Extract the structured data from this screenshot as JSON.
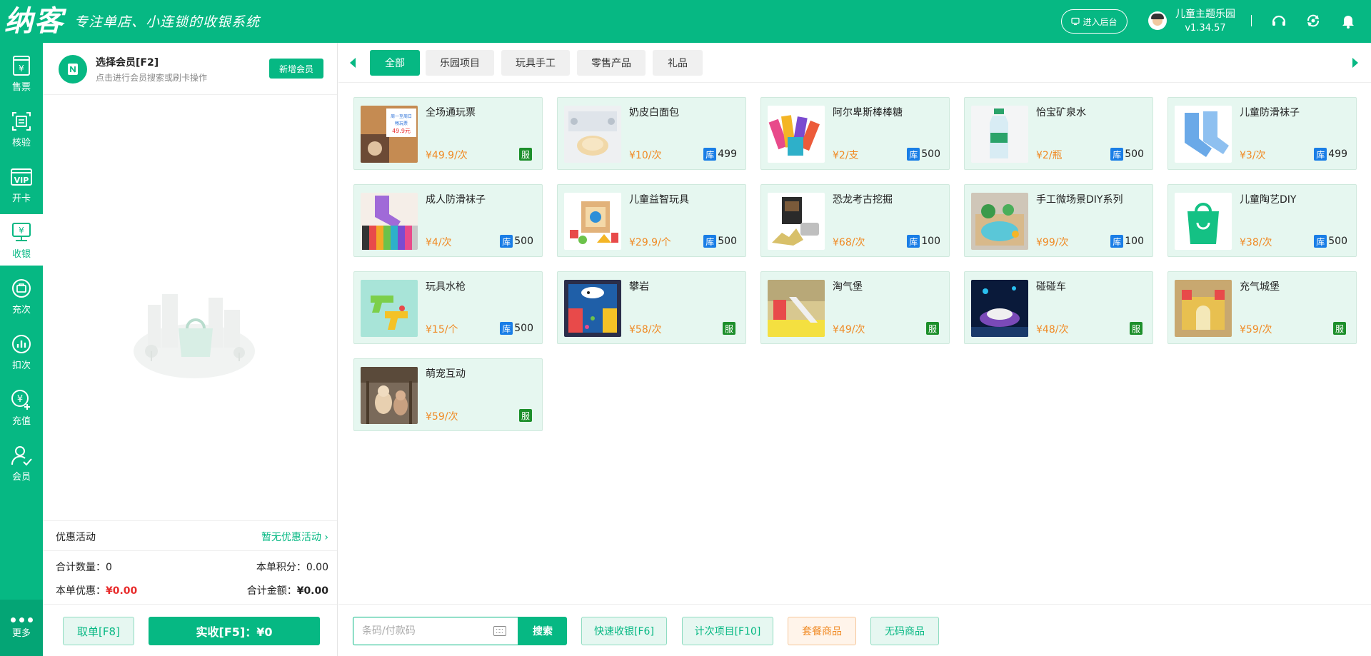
{
  "header": {
    "logo": "纳客",
    "slogan": "专注单店、小连锁的收银系统",
    "backend_label": "进入后台",
    "store_name": "儿童主题乐园",
    "version": "v1.34.57",
    "icons": [
      "headset-icon",
      "sync-icon",
      "bell-icon"
    ]
  },
  "nav": {
    "items": [
      {
        "label": "售票",
        "icon": "ticket-icon"
      },
      {
        "label": "核验",
        "icon": "verify-icon"
      },
      {
        "label": "开卡",
        "icon": "vip-card-icon"
      },
      {
        "label": "收银",
        "icon": "cashier-icon"
      },
      {
        "label": "充次",
        "icon": "recharge-times-icon"
      },
      {
        "label": "扣次",
        "icon": "deduct-times-icon"
      },
      {
        "label": "充值",
        "icon": "recharge-icon"
      },
      {
        "label": "会员",
        "icon": "member-icon"
      }
    ],
    "active": "收银",
    "more_label": "更多"
  },
  "member": {
    "title": "选择会员[F2]",
    "subtitle": "点击进行会员搜索或刷卡操作",
    "new_label": "新增会员"
  },
  "promo": {
    "label": "优惠活动",
    "value": "暂无优惠活动"
  },
  "summary": {
    "qty_label": "合计数量：",
    "qty_value": "0",
    "points_label": "本单积分：",
    "points_value": "0.00",
    "discount_label": "本单优惠：",
    "discount_value": "¥0.00",
    "total_label": "合计金额：",
    "total_value": "¥0.00"
  },
  "actions_left": {
    "cancel": "取单[F8]",
    "pay": "实收[F5]：¥0"
  },
  "categories": [
    "全部",
    "乐园项目",
    "玩具手工",
    "零售产品",
    "礼品"
  ],
  "active_category": "全部",
  "products": [
    {
      "name": "全场通玩票",
      "price": "¥49.9/次",
      "badge": "服",
      "stock": ""
    },
    {
      "name": "奶皮白面包",
      "price": "¥10/次",
      "badge": "库",
      "stock": "499"
    },
    {
      "name": "阿尔卑斯棒棒糖",
      "price": "¥2/支",
      "badge": "库",
      "stock": "500"
    },
    {
      "name": "怡宝矿泉水",
      "price": "¥2/瓶",
      "badge": "库",
      "stock": "500"
    },
    {
      "name": "儿童防滑袜子",
      "price": "¥3/次",
      "badge": "库",
      "stock": "499"
    },
    {
      "name": "成人防滑袜子",
      "price": "¥4/次",
      "badge": "库",
      "stock": "500"
    },
    {
      "name": "儿童益智玩具",
      "price": "¥29.9/个",
      "badge": "库",
      "stock": "500"
    },
    {
      "name": "恐龙考古挖掘",
      "price": "¥68/次",
      "badge": "库",
      "stock": "100"
    },
    {
      "name": "手工微场景DIY系列",
      "price": "¥99/次",
      "badge": "库",
      "stock": "100"
    },
    {
      "name": "儿童陶艺DIY",
      "price": "¥38/次",
      "badge": "库",
      "stock": "500"
    },
    {
      "name": "玩具水枪",
      "price": "¥15/个",
      "badge": "库",
      "stock": "500"
    },
    {
      "name": "攀岩",
      "price": "¥58/次",
      "badge": "服",
      "stock": ""
    },
    {
      "name": "淘气堡",
      "price": "¥49/次",
      "badge": "服",
      "stock": ""
    },
    {
      "name": "碰碰车",
      "price": "¥48/次",
      "badge": "服",
      "stock": ""
    },
    {
      "name": "充气城堡",
      "price": "¥59/次",
      "badge": "服",
      "stock": ""
    },
    {
      "name": "萌宠互动",
      "price": "¥59/次",
      "badge": "服",
      "stock": ""
    }
  ],
  "ticket_thumb_text": {
    "line1": "周一至周日",
    "line2": "畅玩票",
    "line3": "49.9元"
  },
  "search": {
    "placeholder": "条码/付款码",
    "button": "搜索"
  },
  "actions_right": [
    "快速收银[F6]",
    "计次项目[F10]",
    "套餐商品",
    "无码商品"
  ],
  "colors": {
    "primary": "#06b883",
    "price": "#f08a24",
    "stock_badge": "#1a7ee6",
    "service_badge": "#1d8f2b",
    "discount": "#e82c2c"
  }
}
